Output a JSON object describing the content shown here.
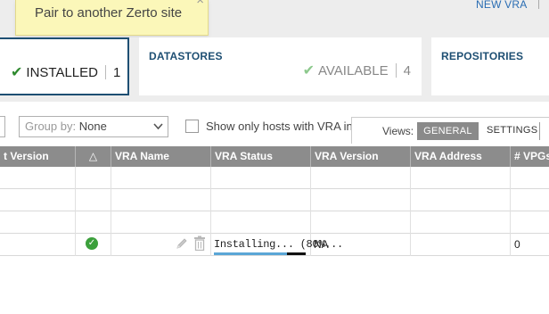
{
  "tooltip": {
    "text": "Pair to another Zerto site",
    "close_glyph": "×"
  },
  "header": {
    "new_vra_label": "NEW VRA"
  },
  "cards": {
    "installed": {
      "label": "INSTALLED",
      "count": "1"
    },
    "datastores": {
      "title": "DATASTORES",
      "status_label": "AVAILABLE",
      "count": "4"
    },
    "repositories": {
      "title": "REPOSITORIES"
    }
  },
  "toolbar": {
    "group_by_label": "Group by:",
    "group_by_value": "None",
    "show_only_label": "Show only hosts with VRA installed",
    "show_only_checked": false,
    "views_label": "Views:",
    "view_general": "GENERAL",
    "view_settings": "SETTINGS",
    "active_view": "GENERAL"
  },
  "table": {
    "columns": [
      "t Version",
      "△",
      "VRA Name",
      "VRA Status",
      "VRA Version",
      "VRA Address",
      "# VPGs"
    ],
    "rows": [
      {
        "status": "",
        "vra_name": "",
        "vra_status": "",
        "vra_version": "",
        "vra_address": "",
        "vpgs": ""
      },
      {
        "status": "",
        "vra_name": "",
        "vra_status": "",
        "vra_version": "",
        "vra_address": "",
        "vpgs": ""
      },
      {
        "status": "",
        "vra_name": "",
        "vra_status": "",
        "vra_version": "",
        "vra_address": "",
        "vpgs": ""
      },
      {
        "status": "ok",
        "vra_name": "",
        "vra_status": "Installing... (80%...",
        "progress_fraction": 0.8,
        "vra_version": "NA",
        "vra_address": "",
        "vpgs": "0"
      }
    ]
  },
  "colors": {
    "accent": "#1e4f73",
    "link": "#2a6db3",
    "success": "#3ca03c",
    "progress": "#5aa6d6",
    "header_bg": "#8c8c8c",
    "tooltip_bg": "#fbf7b9"
  },
  "icons": {
    "installed_check": "check-icon",
    "available_check": "check-icon",
    "status": "check-circle-icon",
    "edit": "pencil-icon",
    "delete": "trash-icon",
    "dropdown": "chevron-down-icon",
    "close": "close-icon"
  }
}
